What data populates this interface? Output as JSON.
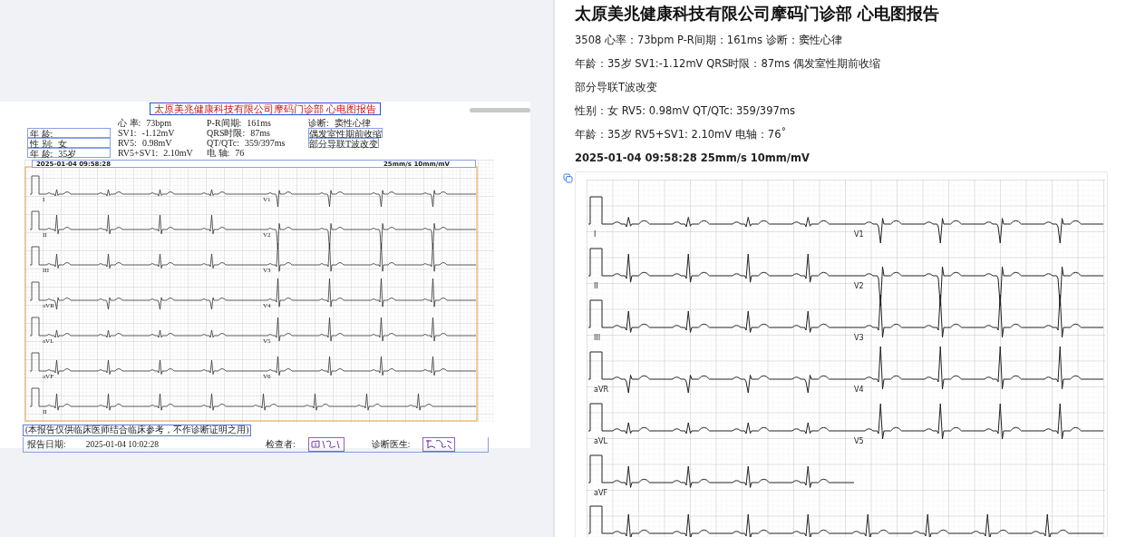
{
  "document": {
    "title": "太原美兆健康科技有限公司摩码门诊部 心电图报告",
    "header_rows": [
      {
        "measure_a": {
          "label": "心 率:",
          "value": "73bpm"
        },
        "measure_b": {
          "label": "P-R间期:",
          "value": "161ms"
        },
        "diagnosis": {
          "label": "诊断:",
          "value": "窦性心律"
        }
      },
      {
        "patient": {
          "label": "年 龄:"
        },
        "measure_a": {
          "label": "SV1:",
          "value": "-1.12mV"
        },
        "measure_b": {
          "label": "QRS时限:",
          "value": "87ms"
        },
        "diagnosis": {
          "value": "偶发室性期前收缩"
        }
      },
      {
        "patient": {
          "label": "性 别:",
          "value": "女"
        },
        "measure_a": {
          "label": "RV5:",
          "value": "0.98mV"
        },
        "measure_b": {
          "label": "QT/QTc:",
          "value": "359/397ms"
        },
        "diagnosis": {
          "value": "部分导联T波改变"
        }
      },
      {
        "patient": {
          "label": "年 龄:",
          "value": "35岁"
        },
        "measure_a": {
          "label": "RV5+SV1:",
          "value": "2.10mV"
        },
        "measure_b": {
          "label": "电 轴:",
          "value": "76"
        }
      }
    ],
    "ecg": {
      "recorded_at": "2025-01-04 09:58:28",
      "scale": "25mm/s 10mm/mV",
      "leads_left": [
        "I",
        "II",
        "III",
        "aVR",
        "aVL",
        "aVF"
      ],
      "leads_right": [
        "V1",
        "V2",
        "V3",
        "V4",
        "V5",
        "V6"
      ],
      "rhythm_lead": "II"
    },
    "disclaimer": "(本报告仅供临床医师结合临床参考，不作诊断证明之用)",
    "report_date_label": "报告日期:",
    "report_date": "2025-01-04 10:02:28",
    "examiner_label": "检查者:",
    "physician_label": "诊断医生:"
  },
  "report_text": {
    "title": "太原美兆健康科技有限公司摩码门诊部 心电图报告",
    "lines": [
      "3508 心率：73bpm P-R间期：161ms 诊断：窦性心律",
      "年龄：35岁 SV1:-1.12mV QRS时限：87ms 偶发室性期前收缩",
      "部分导联T波改变",
      "性别：女 RV5: 0.98mV QT/QTc: 359/397ms",
      "年龄：35岁 RV5+SV1: 2.10mV 电轴：76˚"
    ],
    "summary": "2025-01-04 09:58:28 25mm/s 10mm/mV",
    "ecg": {
      "leads_left": [
        "I",
        "II",
        "III",
        "aVR",
        "aVL",
        "aVF"
      ],
      "leads_right": [
        "V1",
        "V2",
        "V3",
        "V4",
        "V5"
      ]
    }
  }
}
